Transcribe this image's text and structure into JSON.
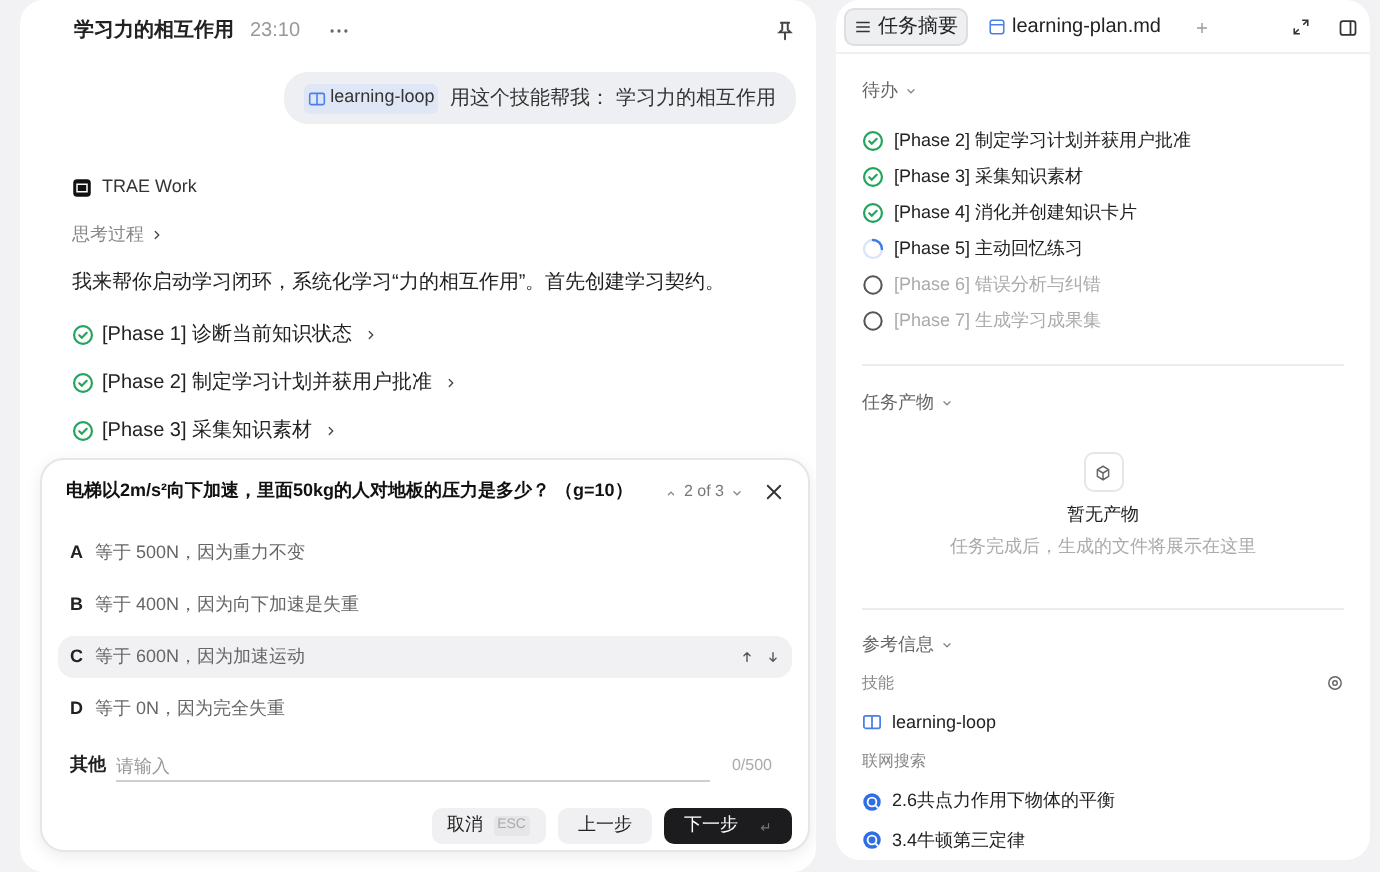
{
  "chat": {
    "title": "学习力的相互作用",
    "time": "23:10",
    "user_message": {
      "skill_tag": "learning-loop",
      "text": "用这个技能帮我： 学习力的相互作用"
    },
    "assistant": {
      "name": "TRAE Work",
      "thinking_label": "思考过程",
      "intro": "我来帮你启动学习闭环，系统化学习“力的相互作用”。首先创建学习契约。",
      "phases": [
        {
          "label": "[Phase 1] 诊断当前知识状态",
          "kind": "done"
        },
        {
          "label": "[Phase 2] 制定学习计划并获用户批准",
          "kind": "done"
        },
        {
          "label": "[Phase 3] 采集知识素材",
          "kind": "done"
        }
      ]
    }
  },
  "question": {
    "text": "电梯以2m/s²向下加速，里面50kg的人对地板的压力是多少？ （g=10）",
    "pager": "2 of 3",
    "options": [
      {
        "letter": "A",
        "text": "等于 500N，因为重力不变",
        "selected": false
      },
      {
        "letter": "B",
        "text": "等于 400N，因为向下加速是失重",
        "selected": false
      },
      {
        "letter": "C",
        "text": "等于 600N，因为加速运动",
        "selected": true
      },
      {
        "letter": "D",
        "text": "等于 0N，因为完全失重",
        "selected": false
      }
    ],
    "other": {
      "label": "其他",
      "placeholder": "请输入",
      "counter": "0/500"
    },
    "buttons": [
      {
        "label": "取消",
        "key": "ESC",
        "kind": "cancel"
      },
      {
        "label": "上一步",
        "kind": "back"
      },
      {
        "label": "下一步",
        "kind": "next"
      }
    ]
  },
  "side": {
    "tabs": [
      {
        "label": "任务摘要",
        "kind": "summary",
        "selected": true
      },
      {
        "label": "learning-plan.md",
        "kind": "file",
        "selected": false
      }
    ],
    "todo": {
      "heading": "待办",
      "items": [
        {
          "label": "[Phase 2] 制定学习计划并获用户批准",
          "kind": "done"
        },
        {
          "label": "[Phase 3] 采集知识素材",
          "kind": "done"
        },
        {
          "label": "[Phase 4] 消化并创建知识卡片",
          "kind": "done"
        },
        {
          "label": "[Phase 5] 主动回忆练习",
          "kind": "running"
        },
        {
          "label": "[Phase 6] 错误分析与纠错",
          "kind": "pending"
        },
        {
          "label": "[Phase 7] 生成学习成果集",
          "kind": "pending"
        }
      ]
    },
    "outputs": {
      "heading": "任务产物",
      "empty_title": "暂无产物",
      "empty_text": "任务完成后，生成的文件将展示在这里"
    },
    "references": {
      "heading": "参考信息",
      "skills_label": "技能",
      "skills": [
        "learning-loop"
      ],
      "search_label": "联网搜索",
      "search_results": [
        "2.6共点力作用下物体的平衡",
        "3.4牛顿第三定律"
      ]
    }
  }
}
